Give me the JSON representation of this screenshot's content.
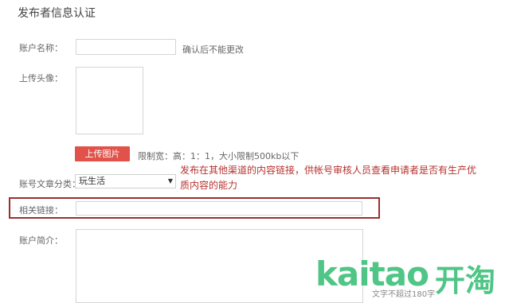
{
  "page": {
    "title": "发布者信息认证"
  },
  "account_name": {
    "label": "账户名称：",
    "value": "",
    "hint": "确认后不能更改"
  },
  "avatar": {
    "label": "上传头像：",
    "upload_button": "上传图片",
    "hint": "限制宽：高：1：1，大小限制500kb以下"
  },
  "category": {
    "label": "账号文章分类：",
    "selected": "玩生活"
  },
  "annotation": {
    "line1": "发布在其他渠道的内容链接，供帐号审核人员查看申请者是否有生产优",
    "line2": "质内容的能力"
  },
  "related_link": {
    "label": "相关链接：",
    "value": ""
  },
  "intro": {
    "label": "账户简介：",
    "counter": "文字不超过180字"
  },
  "watermark": {
    "latin": "kaitao",
    "chinese": "开淘"
  },
  "colors": {
    "upload_button": "#e0524a",
    "annotation_text": "#b5322f",
    "highlight_border": "#9b2f2f",
    "watermark_green": "#3cbf7a"
  }
}
